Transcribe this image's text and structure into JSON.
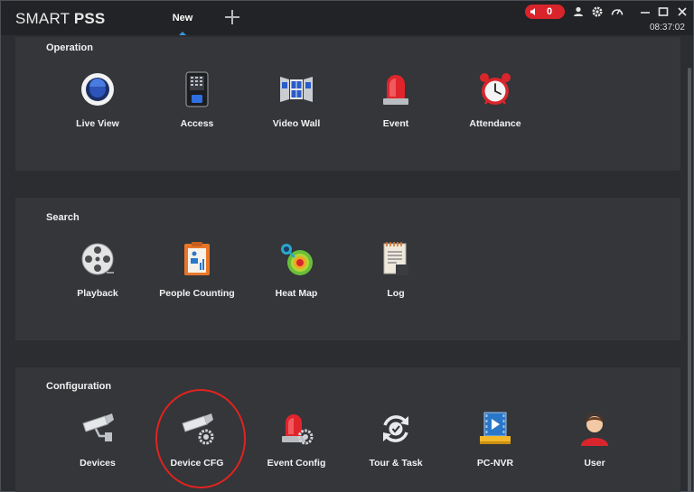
{
  "titlebar": {
    "brand_light": "SMART",
    "brand_bold": "PSS",
    "tab_label": "New",
    "alarm_count": "0",
    "clock": "08:37:02"
  },
  "colors": {
    "titlebar": "#222326",
    "panel": "#34363a",
    "background": "#2b2d30",
    "alarm": "#d9242b",
    "accent": "#3a95d7",
    "highlight_circle": "#e1231f"
  },
  "sections": [
    {
      "title": "Operation",
      "apps": [
        {
          "label": "Live View",
          "icon": "live-view-icon"
        },
        {
          "label": "Access",
          "icon": "access-icon"
        },
        {
          "label": "Video Wall",
          "icon": "video-wall-icon"
        },
        {
          "label": "Event",
          "icon": "event-icon"
        },
        {
          "label": "Attendance",
          "icon": "alarm-clock-icon"
        }
      ]
    },
    {
      "title": "Search",
      "apps": [
        {
          "label": "Playback",
          "icon": "film-reel-icon"
        },
        {
          "label": "People Counting",
          "icon": "people-counting-icon"
        },
        {
          "label": "Heat Map",
          "icon": "heat-map-icon"
        },
        {
          "label": "Log",
          "icon": "log-icon"
        }
      ]
    },
    {
      "title": "Configuration",
      "apps": [
        {
          "label": "Devices",
          "icon": "camera-icon"
        },
        {
          "label": "Device CFG",
          "icon": "camera-gear-icon"
        },
        {
          "label": "Event Config",
          "icon": "event-gear-icon"
        },
        {
          "label": "Tour & Task",
          "icon": "refresh-check-icon"
        },
        {
          "label": "PC-NVR",
          "icon": "pc-nvr-icon"
        },
        {
          "label": "User",
          "icon": "user-icon"
        }
      ]
    }
  ]
}
